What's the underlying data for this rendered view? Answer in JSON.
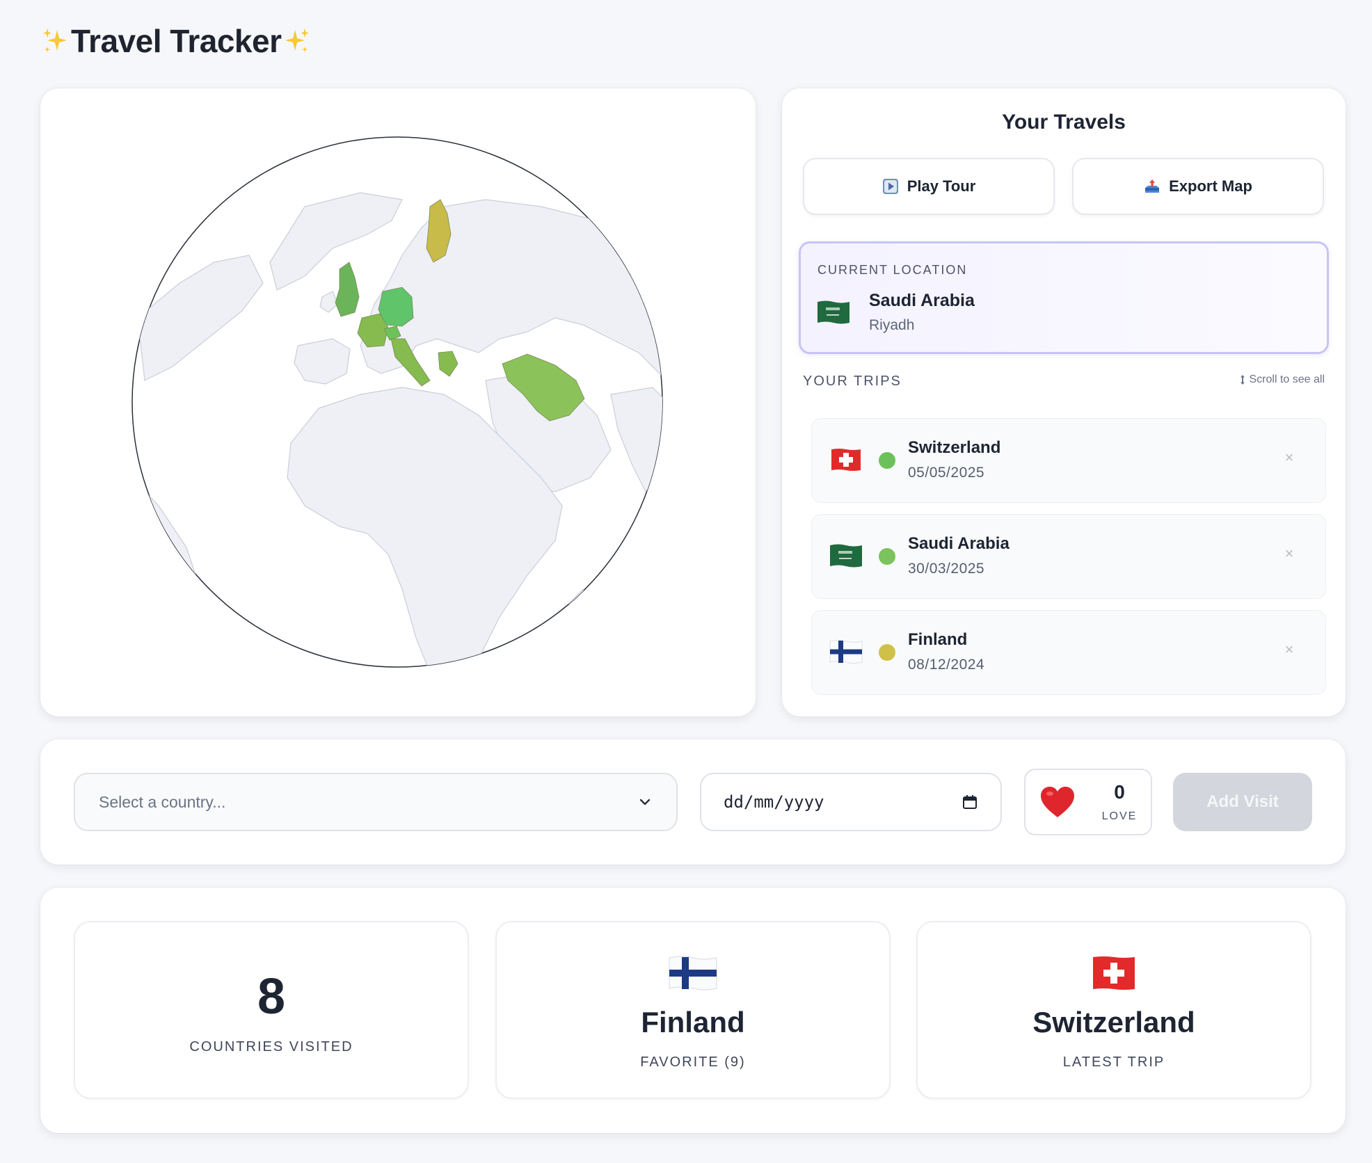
{
  "app": {
    "title": "Travel Tracker"
  },
  "travels": {
    "title": "Your Travels",
    "play_tour_label": "Play Tour",
    "export_map_label": "Export Map",
    "current_location": {
      "label": "CURRENT LOCATION",
      "country": "Saudi Arabia",
      "city": "Riyadh",
      "flag": "saudi-arabia-flag"
    },
    "trips_label": "YOUR TRIPS",
    "scroll_hint": "Scroll to see all",
    "trips": [
      {
        "country": "Switzerland",
        "date": "05/05/2025",
        "flag": "switzerland-flag",
        "dot_color": "#6cc25a",
        "remove": "×"
      },
      {
        "country": "Saudi Arabia",
        "date": "30/03/2025",
        "flag": "saudi-arabia-flag",
        "dot_color": "#7bc35c",
        "remove": "×"
      },
      {
        "country": "Finland",
        "date": "08/12/2024",
        "flag": "finland-flag",
        "dot_color": "#cfc04a",
        "remove": "×"
      }
    ]
  },
  "map": {
    "highlighted_countries": [
      {
        "name": "Finland",
        "color": "#c9bb4a"
      },
      {
        "name": "United Kingdom",
        "color": "#6bb45a"
      },
      {
        "name": "Germany",
        "color": "#5fc46a"
      },
      {
        "name": "Switzerland",
        "color": "#6cc25a"
      },
      {
        "name": "Italy",
        "color": "#86bb50"
      },
      {
        "name": "Greece",
        "color": "#86bb50"
      },
      {
        "name": "Saudi Arabia",
        "color": "#8cc25a"
      },
      {
        "name": "France",
        "color": "#86bb50"
      }
    ]
  },
  "form": {
    "country_placeholder": "Select a country...",
    "date_placeholder": "dd/mm/yyyy",
    "love_count": "0",
    "love_label": "LOVE",
    "add_label": "Add Visit"
  },
  "stats": {
    "countries_visited": "8",
    "countries_visited_label": "COUNTRIES VISITED",
    "favorite_country": "Finland",
    "favorite_label": "FAVORITE (9)",
    "latest_country": "Switzerland",
    "latest_label": "LATEST TRIP"
  },
  "colors": {
    "accent": "#c7c4f4",
    "globe_land": "#eef0f5",
    "globe_border": "#c9ced8"
  }
}
